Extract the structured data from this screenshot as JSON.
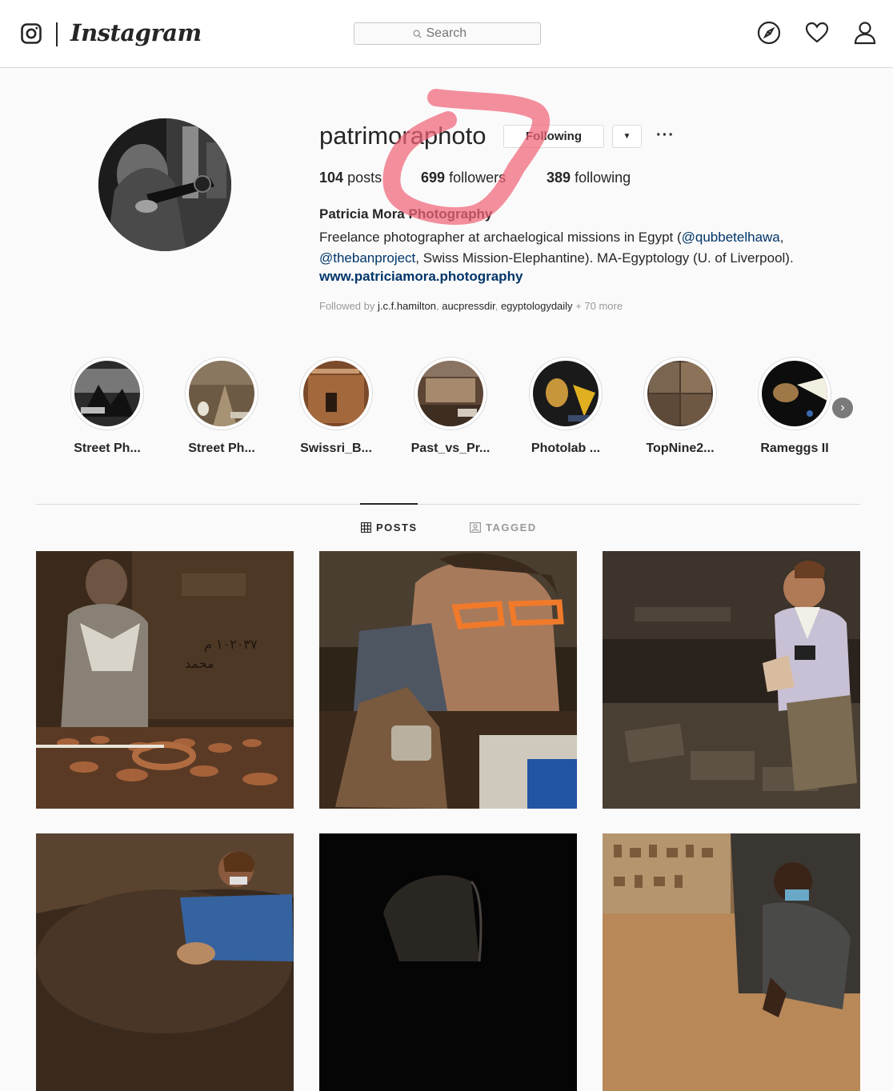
{
  "header": {
    "wordmark": "Instagram",
    "search_placeholder": "Search",
    "icons": [
      "instagram-glyph-icon",
      "search-icon",
      "compass-icon",
      "heart-icon",
      "profile-icon"
    ]
  },
  "profile": {
    "username": "patrimoraphoto",
    "following_button": "Following",
    "posts_count": "104",
    "posts_label": "posts",
    "followers_count": "699",
    "followers_label": "followers",
    "following_count": "389",
    "following_label": "following",
    "full_name": "Patricia Mora Photography",
    "bio_line1_a": "Freelance photographer at archaelogical missions in Egypt (",
    "bio_mention1": "@qubbetelhawa",
    "bio_line1_b": ",",
    "bio_mention2": "@thebanproject",
    "bio_line2_b": ", Swiss Mission-Elephantine). MA-Egyptology (U. of Liverpool).",
    "website": "www.patriciamora.photography",
    "followed_by_label": "Followed by",
    "followed_by_users": [
      "j.c.f.hamilton",
      "aucpressdir",
      "egyptologydaily"
    ],
    "followed_by_more": "+ 70 more"
  },
  "stories": [
    {
      "label": "Street Ph..."
    },
    {
      "label": "Street Ph..."
    },
    {
      "label": "Swissri_B..."
    },
    {
      "label": "Past_vs_Pr..."
    },
    {
      "label": "Photolab ..."
    },
    {
      "label": "TopNine2..."
    },
    {
      "label": "Rameggs II"
    }
  ],
  "tabs": [
    {
      "label": "POSTS",
      "active": true
    },
    {
      "label": "TAGGED",
      "active": false
    }
  ],
  "colors": {
    "link": "#003569",
    "annotation": "#f06478",
    "text": "#262626",
    "muted": "#999999"
  }
}
